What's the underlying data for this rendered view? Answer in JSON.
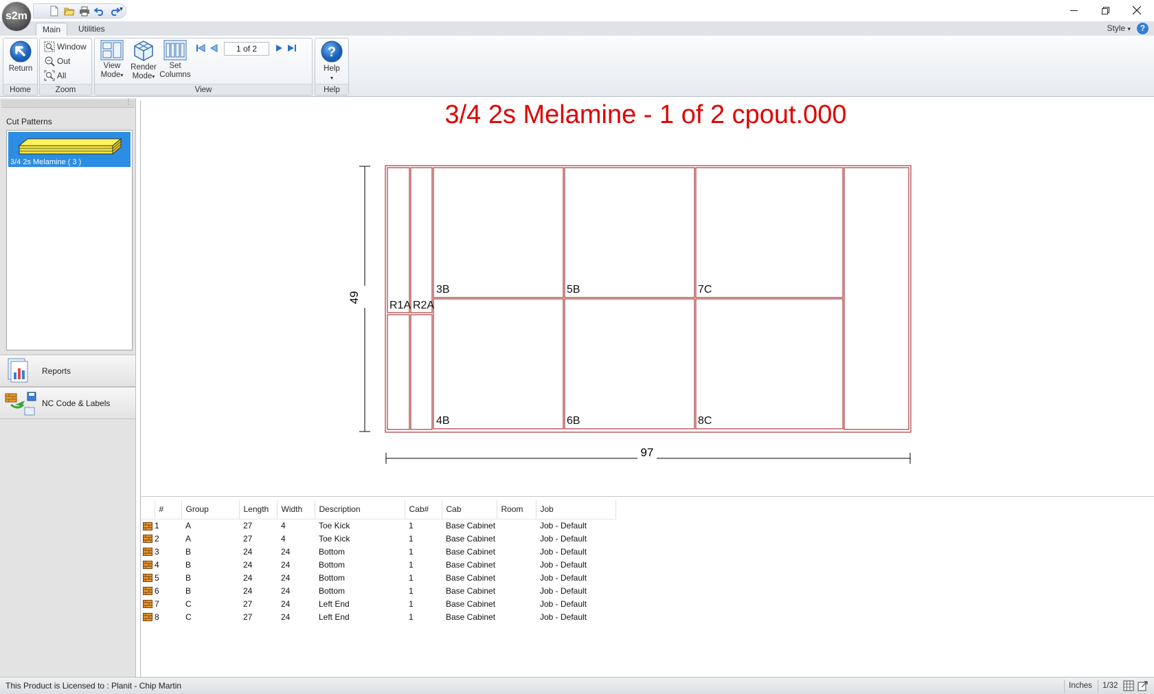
{
  "app": {
    "logo_text": "s2m",
    "style_menu": "Style",
    "help_glyph": "?"
  },
  "quick_access": [
    "new-icon",
    "open-icon",
    "print-icon",
    "undo-icon",
    "redo-icon"
  ],
  "ribbon": {
    "tabs": [
      {
        "label": "Main",
        "active": true
      },
      {
        "label": "Utilities",
        "active": false
      }
    ],
    "groups": {
      "home": {
        "label": "Home",
        "return_label": "Return"
      },
      "zoom": {
        "label": "Zoom",
        "window_label": "Window",
        "out_label": "Out",
        "all_label": "All"
      },
      "view": {
        "label": "View",
        "view_mode_line1": "View",
        "view_mode_line2": "Mode",
        "render_mode_line1": "Render",
        "render_mode_line2": "Mode",
        "set_columns_line1": "Set",
        "set_columns_line2": "Columns",
        "pager_value": "1 of 2"
      },
      "help": {
        "label": "Help",
        "help_label": "Help"
      }
    }
  },
  "left_panel": {
    "cut_patterns_title": "Cut Patterns",
    "selected_pattern": "3/4 2s Melamine  ( 3 )",
    "reports_label": "Reports",
    "nc_code_label": "NC Code & Labels"
  },
  "sheet": {
    "title": "3/4 2s Melamine - 1 of 2 cpout.000",
    "height_dim": "49",
    "width_dim": "97",
    "part_labels": [
      "R1A",
      "R2A",
      "3B",
      "5B",
      "7C",
      "4B",
      "6B",
      "8C"
    ],
    "colors": {
      "title": "#e00000",
      "part_outline": "#b0474c",
      "dimension": "#000000"
    }
  },
  "parts_table": {
    "columns": [
      "#",
      "Group",
      "Length",
      "Width",
      "Description",
      "Cab#",
      "Cab",
      "Room",
      "Job"
    ],
    "rows": [
      [
        "1",
        "A",
        "27",
        "4",
        "Toe Kick",
        "1",
        "Base Cabinet",
        "",
        "Job - Default"
      ],
      [
        "2",
        "A",
        "27",
        "4",
        "Toe Kick",
        "1",
        "Base Cabinet",
        "",
        "Job - Default"
      ],
      [
        "3",
        "B",
        "24",
        "24",
        "Bottom",
        "1",
        "Base Cabinet",
        "",
        "Job - Default"
      ],
      [
        "4",
        "B",
        "24",
        "24",
        "Bottom",
        "1",
        "Base Cabinet",
        "",
        "Job - Default"
      ],
      [
        "5",
        "B",
        "24",
        "24",
        "Bottom",
        "1",
        "Base Cabinet",
        "",
        "Job - Default"
      ],
      [
        "6",
        "B",
        "24",
        "24",
        "Bottom",
        "1",
        "Base Cabinet",
        "",
        "Job - Default"
      ],
      [
        "7",
        "C",
        "27",
        "24",
        "Left End",
        "1",
        "Base Cabinet",
        "",
        "Job - Default"
      ],
      [
        "8",
        "C",
        "27",
        "24",
        "Left End",
        "1",
        "Base Cabinet",
        "",
        "Job - Default"
      ]
    ]
  },
  "status_bar": {
    "license": "This Product is Licensed to : Planit - Chip Martin",
    "units": "Inches",
    "precision": "1/32"
  }
}
